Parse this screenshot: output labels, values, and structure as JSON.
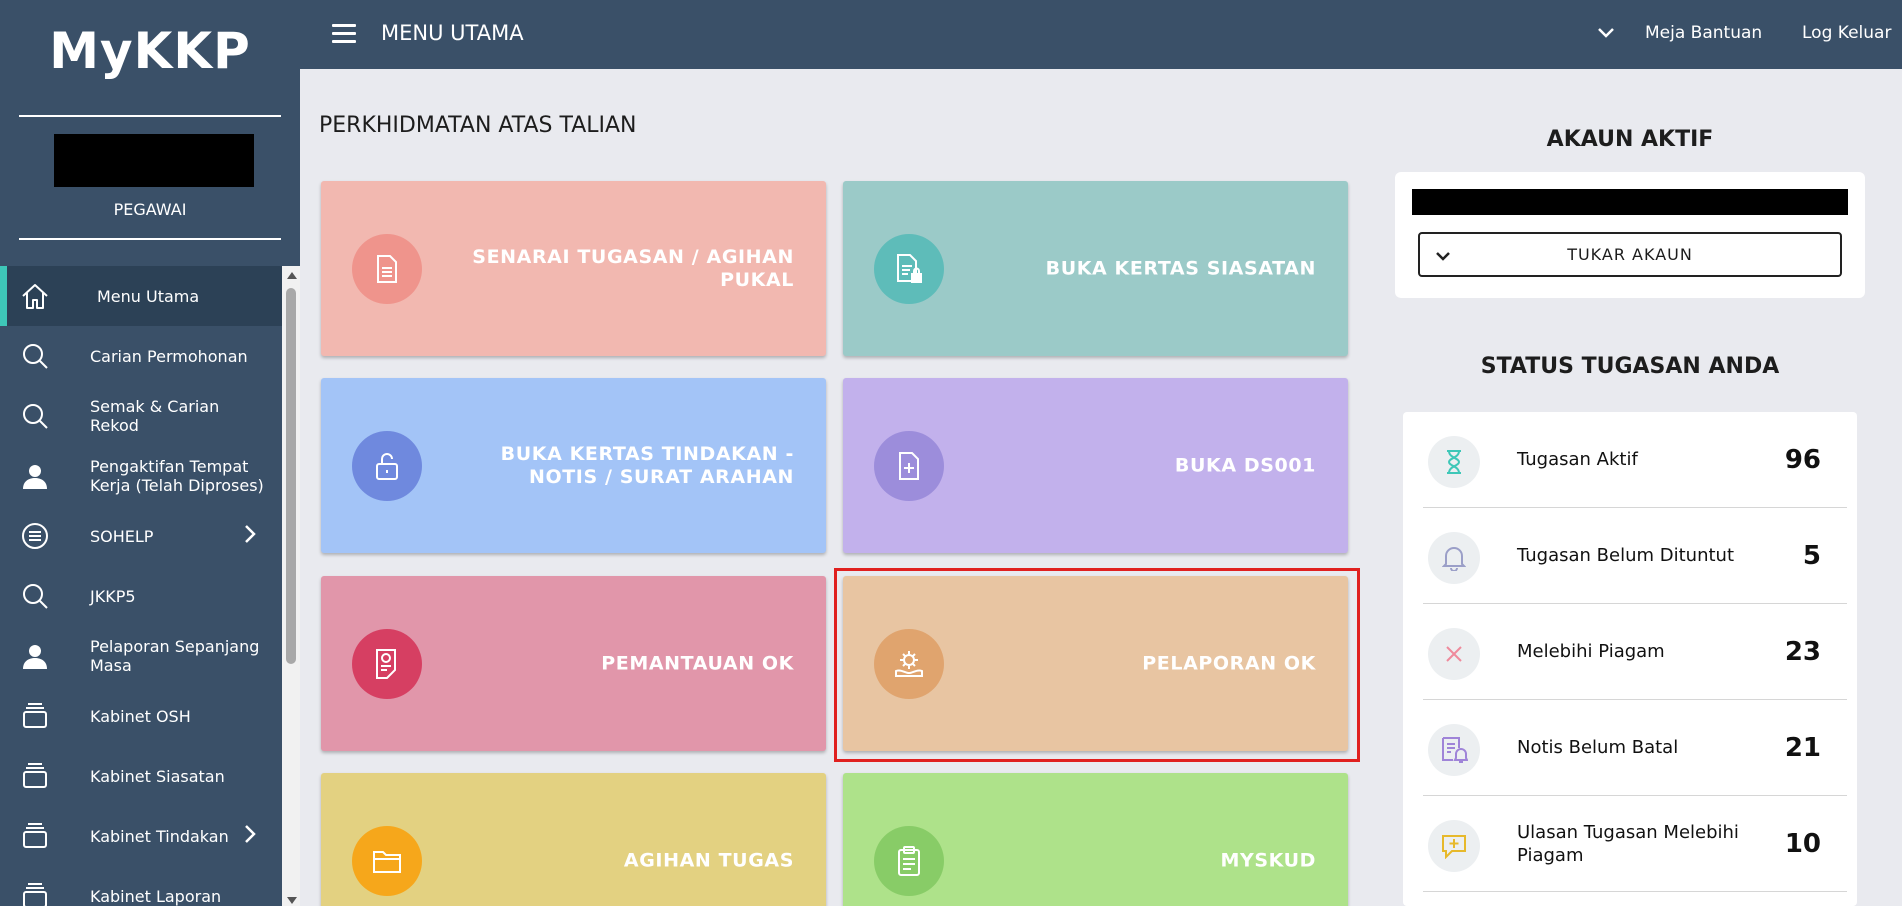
{
  "app": {
    "logo": "MyKKP",
    "role": "PEGAWAI"
  },
  "topbar": {
    "title": "MENU UTAMA",
    "help": "Meja Bantuan",
    "logout": "Log Keluar"
  },
  "sidebar": {
    "items": [
      {
        "label": "Menu Utama",
        "icon": "home-icon",
        "active": true
      },
      {
        "label": "Carian Permohonan",
        "icon": "search-icon"
      },
      {
        "label": "Semak & Carian Rekod",
        "icon": "search-icon"
      },
      {
        "label": "Pengaktifan Tempat Kerja (Telah Diproses)",
        "icon": "user-icon"
      },
      {
        "label": "SOHELP",
        "icon": "list-icon",
        "expandable": true
      },
      {
        "label": "JKKP5",
        "icon": "search-icon"
      },
      {
        "label": "Pelaporan Sepanjang Masa",
        "icon": "user-icon"
      },
      {
        "label": "Kabinet OSH",
        "icon": "stack-icon"
      },
      {
        "label": "Kabinet Siasatan",
        "icon": "stack-icon"
      },
      {
        "label": "Kabinet Tindakan",
        "icon": "stack-icon",
        "expandable": true
      },
      {
        "label": "Kabinet Laporan",
        "icon": "stack-icon"
      }
    ]
  },
  "main": {
    "section_title": "PERKHIDMATAN ATAS TALIAN",
    "tiles": [
      {
        "label": "SENARAI TUGASAN / AGIHAN PUKAL",
        "icon": "document-icon",
        "bg": "#f2b8b0",
        "icon_bg": "#ef948c"
      },
      {
        "label": "BUKA KERTAS SIASATAN",
        "icon": "document-lock-icon",
        "bg": "#9bcac8",
        "icon_bg": "#5ebcb9"
      },
      {
        "label": "BUKA KERTAS TINDAKAN - NOTIS / SURAT ARAHAN",
        "icon": "unlock-icon",
        "bg": "#a3c4f7",
        "icon_bg": "#6f89de"
      },
      {
        "label": "BUKA DS001",
        "icon": "file-plus-icon",
        "bg": "#c2b1ec",
        "icon_bg": "#9c8ddb"
      },
      {
        "label": "PEMANTAUAN OK",
        "icon": "report-icon",
        "bg": "#e196aa",
        "icon_bg": "#d63f62"
      },
      {
        "label": "PELAPORAN OK",
        "icon": "gear-hand-icon",
        "bg": "#e8c5a2",
        "icon_bg": "#e0a46e"
      },
      {
        "label": "AGIHAN TUGAS",
        "icon": "folder-icon",
        "bg": "#e3d181",
        "icon_bg": "#f6a71b"
      },
      {
        "label": "MYSKUD",
        "icon": "clipboard-icon",
        "bg": "#aee28a",
        "icon_bg": "#88cc67"
      }
    ]
  },
  "account": {
    "title": "AKAUN AKTIF",
    "switch_label": "TUKAR AKAUN"
  },
  "status": {
    "title": "STATUS TUGASAN ANDA",
    "rows": [
      {
        "label": "Tugasan Aktif",
        "count": "96",
        "icon": "hourglass-icon",
        "color": "#3ec7b8"
      },
      {
        "label": "Tugasan Belum Dituntut",
        "count": "5",
        "icon": "bell-icon",
        "color": "#9b9fc8"
      },
      {
        "label": "Melebihi Piagam",
        "count": "23",
        "icon": "close-icon",
        "color": "#ef8a9c"
      },
      {
        "label": "Notis Belum Batal",
        "count": "21",
        "icon": "notice-icon",
        "color": "#9f84d8"
      },
      {
        "label": "Ulasan Tugasan Melebihi Piagam",
        "count": "10",
        "icon": "comment-plus-icon",
        "color": "#e7b92b"
      }
    ]
  }
}
